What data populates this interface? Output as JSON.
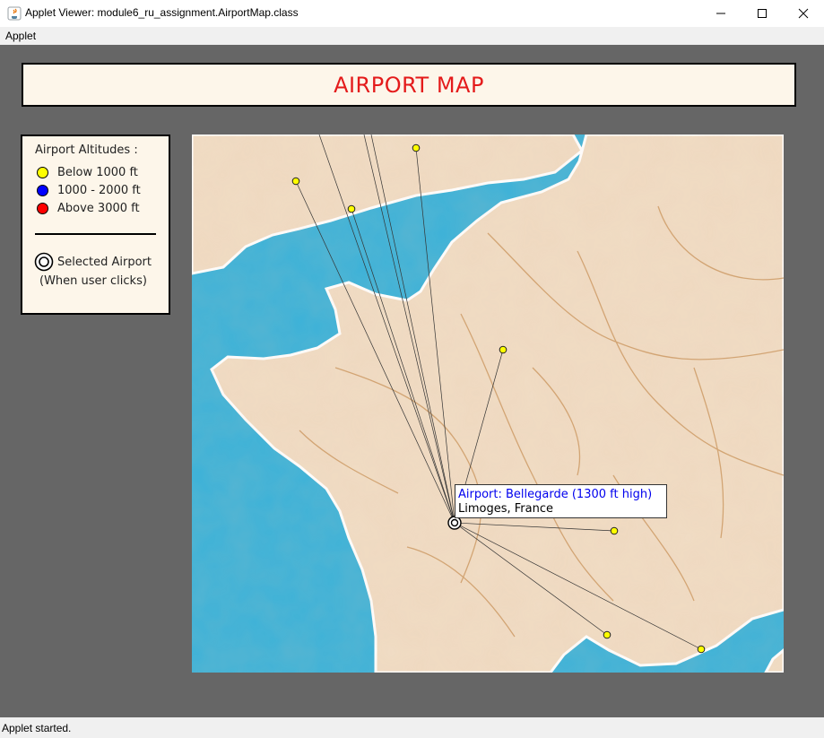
{
  "window": {
    "title": "Applet Viewer: module6_ru_assignment.AirportMap.class",
    "icon": "java-icon",
    "controls": [
      "minimize-icon",
      "maximize-icon",
      "close-icon"
    ]
  },
  "menu": {
    "items": [
      "Applet"
    ]
  },
  "header": {
    "title": "AIRPORT MAP",
    "title_color": "#e41b1b"
  },
  "legend": {
    "heading": "Airport Altitudes :",
    "items": [
      {
        "label": "Below 1000 ft",
        "color": "#ffff00"
      },
      {
        "label": "1000 - 2000 ft",
        "color": "#0000ff"
      },
      {
        "label": "Above 3000 ft",
        "color": "#ff0000"
      }
    ],
    "selected_label": "Selected Airport",
    "selected_note": "(When user clicks)"
  },
  "popup": {
    "line1": "Airport: Bellegarde (1300 ft high)",
    "line2": "Limoges, France",
    "line1_color": "#0000ee"
  },
  "map": {
    "sea_color": "#3bb2d9",
    "land_color": "#f0dcc4",
    "road_color": "#c9935a",
    "airport_color": "#ffff00"
  },
  "status": {
    "text": "Applet started."
  }
}
